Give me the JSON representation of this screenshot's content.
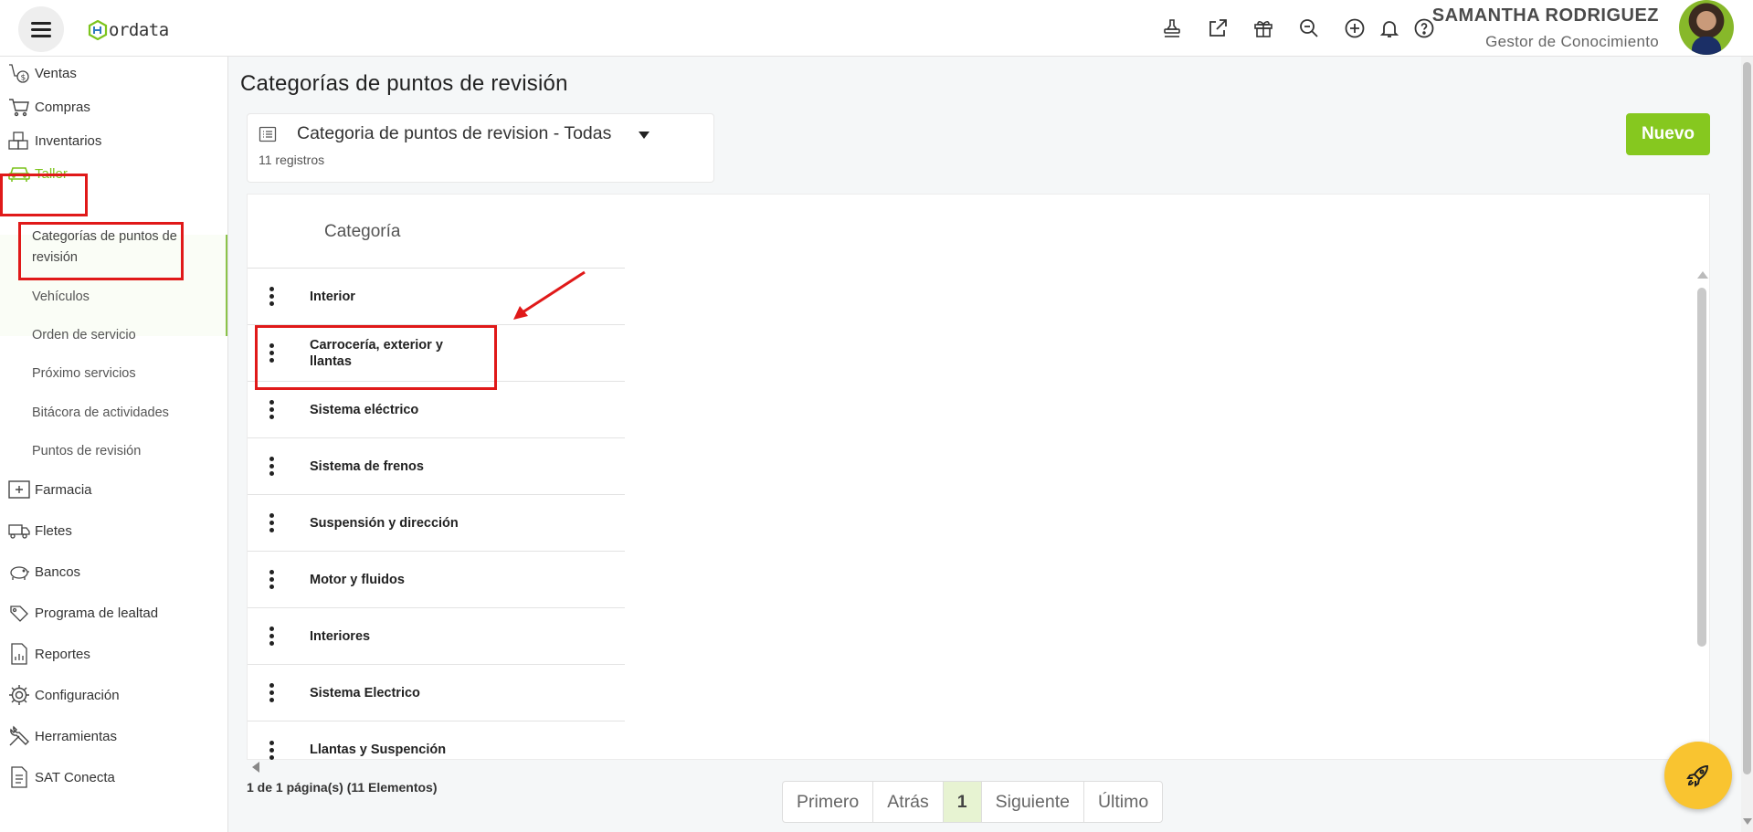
{
  "header": {
    "logo_text": "ordata",
    "user_name": "SAMANTHA RODRIGUEZ",
    "user_role": "Gestor de Conocimiento",
    "icons": [
      "stamp-icon",
      "external-link-icon",
      "gift-icon",
      "search-icon",
      "add-circle-icon",
      "bell-icon",
      "help-icon"
    ]
  },
  "sidebar": {
    "items": [
      {
        "label": "Ventas",
        "icon": "sales-icon"
      },
      {
        "label": "Compras",
        "icon": "cart-icon"
      },
      {
        "label": "Inventarios",
        "icon": "boxes-icon"
      },
      {
        "label": "Taller",
        "icon": "car-icon",
        "active": true
      },
      {
        "label": "Farmacia",
        "icon": "pharmacy-icon"
      },
      {
        "label": "Fletes",
        "icon": "truck-icon"
      },
      {
        "label": "Bancos",
        "icon": "piggy-bank-icon"
      },
      {
        "label": "Programa de lealtad",
        "icon": "loyalty-icon"
      },
      {
        "label": "Reportes",
        "icon": "report-icon"
      },
      {
        "label": "Configuración",
        "icon": "gear-icon"
      },
      {
        "label": "Herramientas",
        "icon": "tools-icon"
      },
      {
        "label": "SAT Conecta",
        "icon": "document-icon"
      }
    ],
    "taller_sub": [
      {
        "label": "Categorías de puntos de revisión",
        "active": true
      },
      {
        "label": "Vehículos"
      },
      {
        "label": "Orden de servicio"
      },
      {
        "label": "Próximo servicios"
      },
      {
        "label": "Bitácora de actividades"
      },
      {
        "label": "Puntos de revisión"
      }
    ]
  },
  "main": {
    "title": "Categorías de puntos de revisión",
    "filter_label": "Categoria de puntos de revision - Todas",
    "record_count": "11 registros",
    "new_button": "Nuevo",
    "column_header": "Categoría",
    "rows": [
      "Interior",
      "Carrocería, exterior y llantas",
      "Sistema eléctrico",
      "Sistema de frenos",
      "Suspensión y dirección",
      "Motor y fluidos",
      "Interiores",
      "Sistema Electrico",
      "Llantas y Suspención"
    ],
    "page_info": "1 de 1 página(s) (11 Elementos)",
    "pagination": {
      "first": "Primero",
      "prev": "Atrás",
      "current": "1",
      "next": "Siguiente",
      "last": "Último"
    }
  },
  "colors": {
    "accent": "#86c81f",
    "highlight": "#e01919",
    "fab": "#f9c430"
  }
}
